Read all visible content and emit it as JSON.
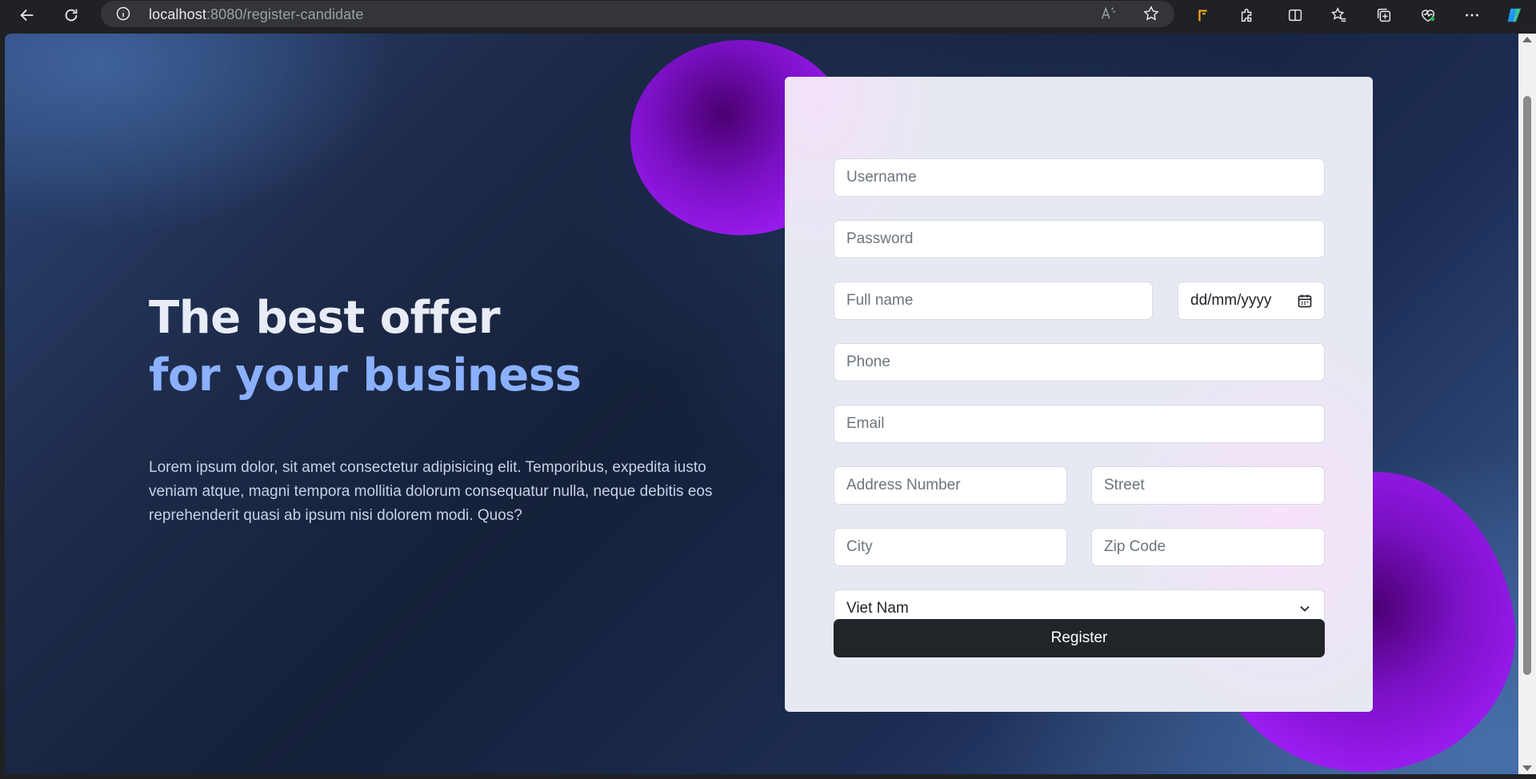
{
  "browser": {
    "url_host": "localhost",
    "url_path": ":8080/register-candidate",
    "icons": [
      "back-arrow-icon",
      "refresh-icon",
      "info-icon",
      "read-aloud-icon",
      "favorite-star-icon",
      "extension-icon",
      "puzzle-icon",
      "split-screen-icon",
      "favorites-icon",
      "collections-icon",
      "health-icon",
      "more-icon",
      "copilot-icon"
    ]
  },
  "hero": {
    "title_line1": "The best offer",
    "title_line2": "for your business",
    "description": "Lorem ipsum dolor, sit amet consectetur adipisicing elit. Temporibus, expedita iusto veniam atque, magni tempora mollitia dolorum consequatur nulla, neque debitis eos reprehenderit quasi ab ipsum nisi dolorem modi. Quos?"
  },
  "form": {
    "username_placeholder": "Username",
    "password_placeholder": "Password",
    "fullname_placeholder": "Full name",
    "dob_placeholder": "dd/mm/yyyy",
    "phone_placeholder": "Phone",
    "email_placeholder": "Email",
    "address_number_placeholder": "Address Number",
    "street_placeholder": "Street",
    "city_placeholder": "City",
    "zip_placeholder": "Zip Code",
    "country_selected": "Viet Nam",
    "register_label": "Register"
  },
  "colors": {
    "accent_title": "#8ab0ff",
    "button_bg": "#212529",
    "blob": "#9b1cf0"
  }
}
